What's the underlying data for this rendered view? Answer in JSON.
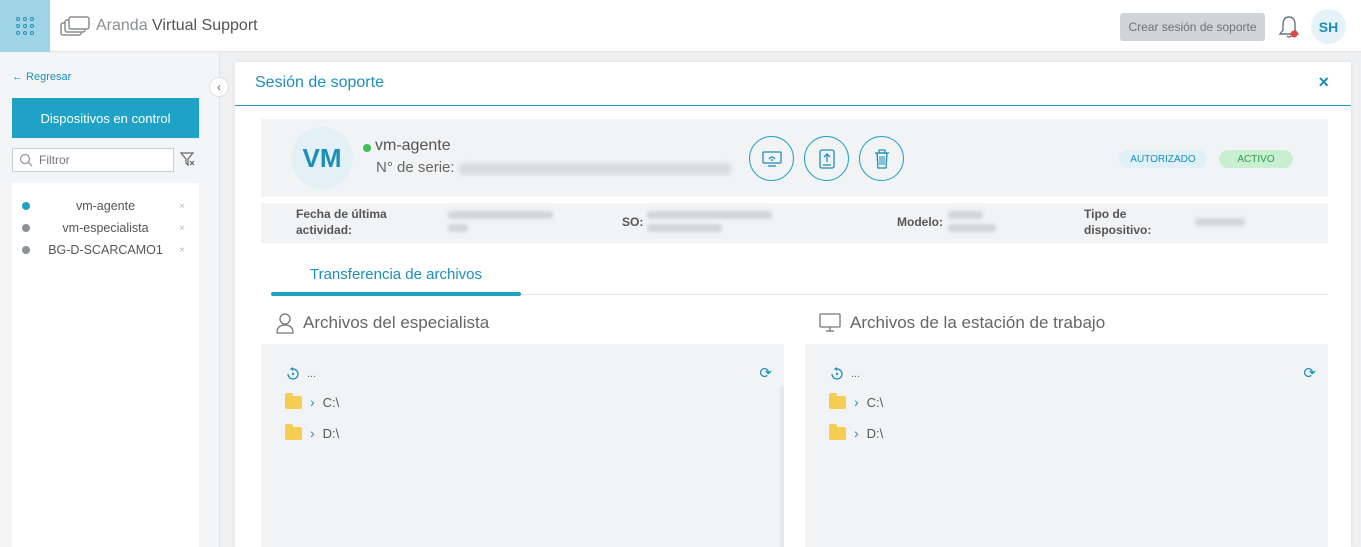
{
  "header": {
    "logo_brand": "Aranda",
    "logo_product": "Virtual Support",
    "create_session_label": "Crear sesión de soporte",
    "user_initials": "SH",
    "accent": "#1ea3c6"
  },
  "sidebar": {
    "back_label": "← Regresar",
    "devices_button_label": "Dispositivos en control",
    "filter_placeholder": "Filtror",
    "devices": [
      {
        "name": "vm-agente",
        "dot_color": "#1ea3c6"
      },
      {
        "name": "vm-especialista",
        "dot_color": "#8a9096"
      },
      {
        "name": "BG-D-SCARCAMO1",
        "dot_color": "#8a9096"
      }
    ],
    "close_glyph": "×"
  },
  "panel": {
    "title": "Sesión de soporte",
    "close_glyph": "×",
    "device": {
      "initials": "VM",
      "name": "vm-agente",
      "serial_label": "N° de serie:",
      "status_authorized": "AUTORIZADO",
      "status_active": "ACTIVO"
    },
    "meta": {
      "last_activity_label_1": "Fecha de última",
      "last_activity_label_2": "actividad:",
      "os_label": "SO:",
      "model_label": "Modelo:",
      "device_type_label_1": "Tipo de",
      "device_type_label_2": "dispositivo:"
    },
    "tab_label": "Transferencia de archivos",
    "specialist_files_title": "Archivos del especialista",
    "workstation_files_title": "Archivos de la estación de trabajo",
    "up_label": "...",
    "drives": [
      "C:\\",
      "D:\\"
    ]
  }
}
